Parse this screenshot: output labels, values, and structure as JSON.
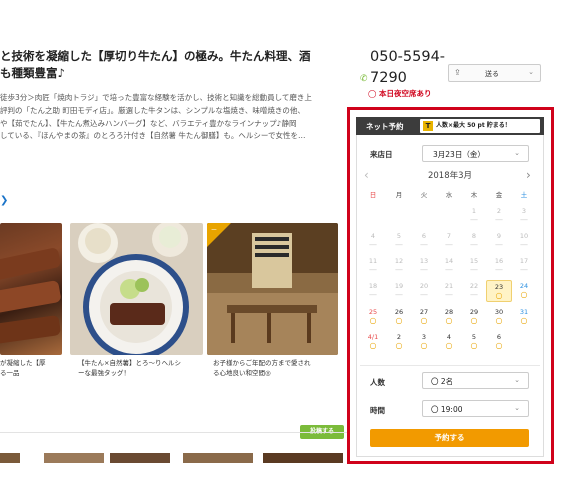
{
  "left": {
    "headline": "と技術を凝縮した【厚切り牛たん】の極み。牛たん料理、酒\nも種類豊富♪",
    "description": "徒歩3分＞肉匠「焼肉トラジ」で培った豊富な経験を活かし、技術と知識を総動員して磨き上\n評判の「たん之助 町田モディ店」。厳選した牛タンは、シンプルな塩焼き、味噌焼きの他、\nや【茹でたん】、【牛たん煮込みハンバーグ】など、バラエティ豊かなラインナップ♪静岡\nしている、『ほんやまの茶』のとろろ汁付き【自然薯 牛たん御膳】も。ヘルシーで女性を…",
    "cards": [
      {
        "caption": "が凝縮した【厚\nる一品"
      },
      {
        "caption": "【牛たん×自然薯】とろ〜りヘルシ\nーな最強タッグ！"
      },
      {
        "caption": "お子様からご年配の方まで愛され\nる心地良い和空間◎",
        "badge": "ー"
      }
    ],
    "post_button": "投稿する",
    "colors": {
      "accent_green": "#7bbb3a",
      "link_blue": "#1a73c8"
    }
  },
  "contact": {
    "phone": "050-5594-\n7290",
    "phone_icon": "phone-icon",
    "send_label": "送る",
    "vacancy": "本日夜空席あり"
  },
  "reservation": {
    "header": "ネット予約",
    "points_icon_text": "T",
    "points_text": "人数×最大 50 pt 貯まる！",
    "date_label": "来店日",
    "date_value": "3月23日（金）",
    "month": "2018年3月",
    "weekdays": [
      "日",
      "月",
      "火",
      "水",
      "木",
      "金",
      "土"
    ],
    "weeks": [
      [
        null,
        null,
        null,
        null,
        {
          "d": "1",
          "a": false
        },
        {
          "d": "2",
          "a": false
        },
        {
          "d": "3",
          "a": false
        }
      ],
      [
        {
          "d": "4",
          "a": false
        },
        {
          "d": "5",
          "a": false
        },
        {
          "d": "6",
          "a": false
        },
        {
          "d": "7",
          "a": false
        },
        {
          "d": "8",
          "a": false
        },
        {
          "d": "9",
          "a": false
        },
        {
          "d": "10",
          "a": false
        }
      ],
      [
        {
          "d": "11",
          "a": false
        },
        {
          "d": "12",
          "a": false
        },
        {
          "d": "13",
          "a": false
        },
        {
          "d": "14",
          "a": false
        },
        {
          "d": "15",
          "a": false
        },
        {
          "d": "16",
          "a": false
        },
        {
          "d": "17",
          "a": false
        }
      ],
      [
        {
          "d": "18",
          "a": false
        },
        {
          "d": "19",
          "a": false
        },
        {
          "d": "20",
          "a": false
        },
        {
          "d": "21",
          "a": false
        },
        {
          "d": "22",
          "a": false
        },
        {
          "d": "23",
          "a": true,
          "today": true
        },
        {
          "d": "24",
          "a": true
        }
      ],
      [
        {
          "d": "25",
          "a": true
        },
        {
          "d": "26",
          "a": true
        },
        {
          "d": "27",
          "a": true
        },
        {
          "d": "28",
          "a": true
        },
        {
          "d": "29",
          "a": true
        },
        {
          "d": "30",
          "a": true
        },
        {
          "d": "31",
          "a": true
        }
      ],
      [
        {
          "d": "4/1",
          "a": true
        },
        {
          "d": "2",
          "a": true
        },
        {
          "d": "3",
          "a": true
        },
        {
          "d": "4",
          "a": true
        },
        {
          "d": "5",
          "a": true
        },
        {
          "d": "6",
          "a": true
        },
        null
      ]
    ],
    "available_mark": "○",
    "unavailable_mark": "—",
    "people_label": "人数",
    "people_value": "〇 2名",
    "time_label": "時間",
    "time_value": "〇 19:00",
    "submit_label": "予約する",
    "colors": {
      "highlight_red": "#d0021b",
      "submit_orange": "#f29a00",
      "header_dark": "#3c3c3c"
    }
  }
}
